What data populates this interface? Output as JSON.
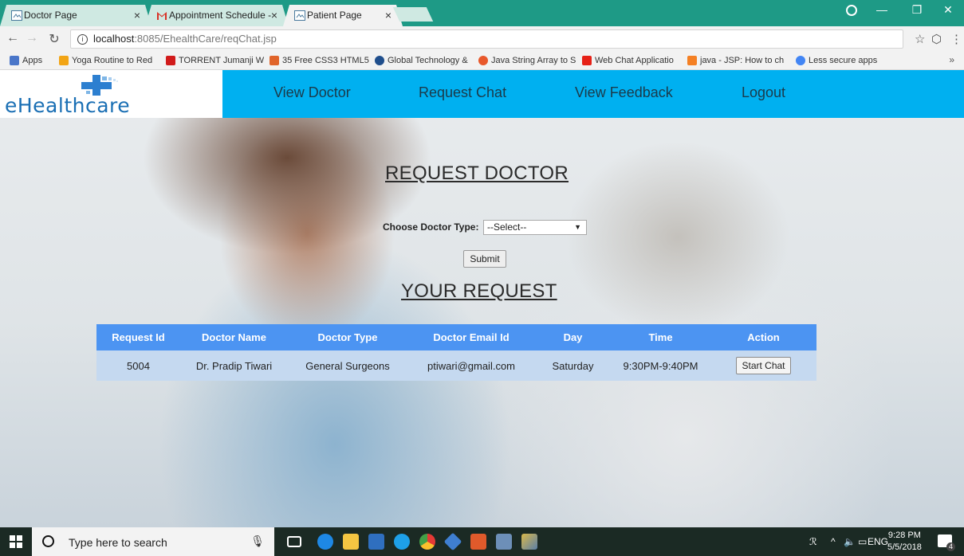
{
  "browser": {
    "tabs": [
      {
        "title": "Doctor Page",
        "active": false
      },
      {
        "title": "Appointment Schedule -",
        "active": false
      },
      {
        "title": "Patient Page",
        "active": true
      }
    ],
    "url_host": "localhost",
    "url_path": ":8085/EhealthCare/reqChat.jsp",
    "bookmarks": [
      {
        "label": "Apps",
        "color": "#4a76c9"
      },
      {
        "label": "Yoga Routine to Red",
        "color": "#f2a516"
      },
      {
        "label": "TORRENT Jumanji W",
        "color": "#d11b1b"
      },
      {
        "label": "35 Free CSS3 HTML5",
        "color": "#e0642a"
      },
      {
        "label": "Global Technology &",
        "color": "#1f4e8c"
      },
      {
        "label": "Java String Array to S",
        "color": "#e8582b"
      },
      {
        "label": "Web Chat Applicatio",
        "color": "#e62117"
      },
      {
        "label": "java - JSP: How to ch",
        "color": "#f48024"
      },
      {
        "label": "Less secure apps",
        "color": "#4285f4"
      }
    ],
    "bookmarks_more": "»"
  },
  "site": {
    "logo_text": "eHealthcare",
    "nav": [
      "View Doctor",
      "Request Chat",
      "View Feedback",
      "Logout"
    ]
  },
  "request_form": {
    "heading": "REQUEST DOCTOR",
    "label": "Choose Doctor Type:",
    "select_value": "--Select--",
    "submit_label": "Submit"
  },
  "requests": {
    "heading": "YOUR REQUEST",
    "columns": [
      "Request Id",
      "Doctor Name",
      "Doctor Type",
      "Doctor Email Id",
      "Day",
      "Time",
      "Action"
    ],
    "rows": [
      {
        "id": "5004",
        "doctor_name": "Dr. Pradip Tiwari",
        "doctor_type": "General Surgeons",
        "email": "ptiwari@gmail.com",
        "day": "Saturday",
        "time": "9:30PM-9:40PM",
        "action": "Start Chat"
      }
    ]
  },
  "taskbar": {
    "search_placeholder": "Type here to search",
    "language": "ENG",
    "time": "9:28 PM",
    "date": "5/5/2018",
    "notification_count": "4"
  },
  "colors": {
    "header": "#00b0f0",
    "table_header": "#4c94f2",
    "table_row": "#c5d9f0",
    "chrome_frame": "#1e9a86"
  }
}
